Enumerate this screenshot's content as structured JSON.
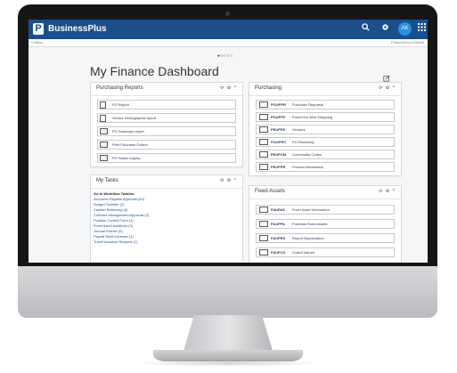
{
  "app": {
    "logo_letter": "P",
    "title": "BusinessPlus"
  },
  "topbar": {
    "search_icon": "search-icon",
    "settings_icon": "gear-icon",
    "avatar_initials": "AK",
    "apps_icon": "grid-icon"
  },
  "subbar": {
    "menu_label": "≡ Menu",
    "district": "PowerSchool District"
  },
  "carousel": {
    "dots": "●○○○○"
  },
  "dashboard": {
    "title": "My Finance Dashboard",
    "edit_icon": "edit-icon"
  },
  "panel_controls": "⟳ ⚙ ^",
  "purchasing_reports": {
    "title": "Purchasing Reports",
    "items": [
      {
        "label": "PO Report",
        "icon": "document-icon"
      },
      {
        "label": "Vendor Demographic report",
        "icon": "document-icon"
      },
      {
        "label": "PO Summary report",
        "icon": "report-icon"
      },
      {
        "label": "Print Purchase Orders",
        "icon": "report-icon"
      },
      {
        "label": "PO Status Inquiry",
        "icon": "report-icon"
      }
    ]
  },
  "my_tasks": {
    "title": "My Tasks",
    "heading": "Go to Workflow Tasklist",
    "items": [
      "Accounts Payable Approval (24)",
      "Budget Transfer (2)",
      "Cashier Balancing (4)",
      "Contract Management Approval (2)",
      "Position Control Form (1)",
      "Fixed Asset Additions (3)",
      "Journal Entries (5)",
      "Payroll Merit Increase (1)",
      "Travel Advance Request (1)"
    ]
  },
  "purchasing": {
    "title": "Purchasing",
    "items": [
      {
        "code": "POUPPR",
        "label": "Purchase Requests"
      },
      {
        "code": "POUPPF",
        "label": "PunchOut Web Shopping"
      },
      {
        "code": "PEUPPE",
        "label": "Vendors"
      },
      {
        "code": "POUPRC",
        "label": "PO Receiving"
      },
      {
        "code": "PEUPCM",
        "label": "Commodity Codes"
      },
      {
        "code": "PEUPPR",
        "label": "Product Information"
      }
    ]
  },
  "fixed_assets": {
    "title": "Fixed Assets",
    "items": [
      {
        "code": "FAUPAS",
        "label": "Fixed Asset Information"
      },
      {
        "code": "FAUPPA",
        "label": "Potential Fixed Assets"
      },
      {
        "code": "FAUPRS",
        "label": "Report Depreciation"
      },
      {
        "code": "FAUPCD",
        "label": "Coded Values"
      }
    ]
  }
}
